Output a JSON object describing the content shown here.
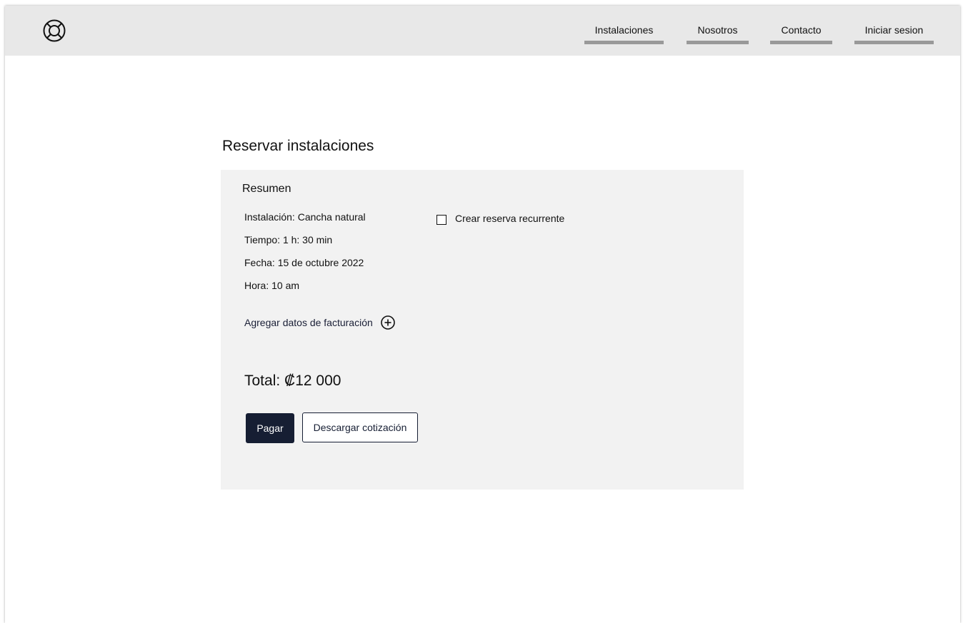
{
  "nav": {
    "logo_icon": "lifebuoy-icon",
    "items": [
      {
        "label": "Instalaciones"
      },
      {
        "label": "Nosotros"
      },
      {
        "label": "Contacto"
      },
      {
        "label": "Iniciar sesion"
      }
    ]
  },
  "page": {
    "title": "Reservar instalaciones"
  },
  "summary": {
    "title": "Resumen",
    "facility": "Instalación: Cancha natural",
    "duration": "Tiempo: 1 h: 30 min",
    "date": "Fecha: 15 de octubre 2022",
    "time": "Hora: 10 am",
    "recurring_label": "Crear reserva recurrente",
    "recurring_checked": false,
    "billing_label": "Agregar datos de facturación",
    "billing_icon": "plus-circle-icon",
    "total": "Total: ₡12 000",
    "pay_label": "Pagar",
    "quote_label": "Descargar cotización"
  },
  "colors": {
    "navbar_bg": "#e8e8e8",
    "nav_underline": "#999999",
    "card_bg": "#f2f2f2",
    "primary": "#161e33"
  }
}
